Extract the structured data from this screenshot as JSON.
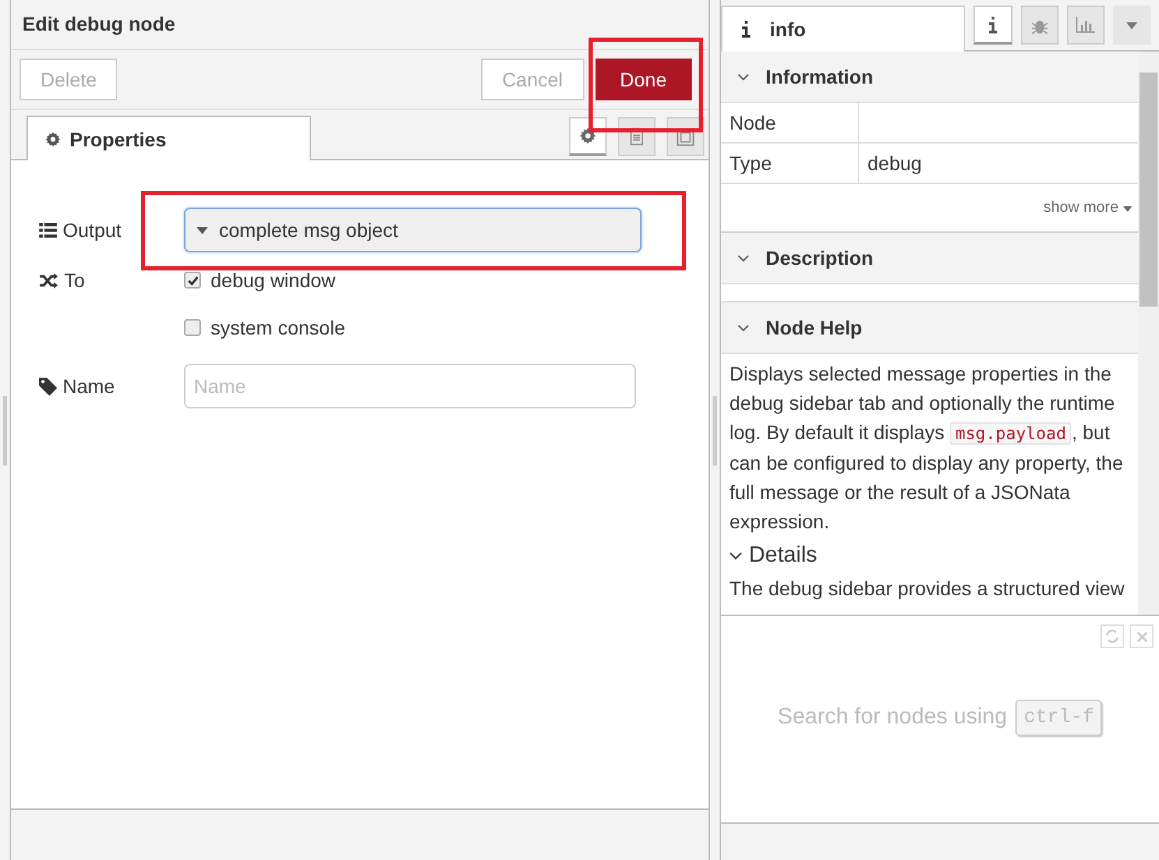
{
  "editor": {
    "title": "Edit debug node",
    "buttons": [
      {
        "label": "Delete",
        "kind": "default"
      },
      {
        "label": "Cancel",
        "kind": "default"
      },
      {
        "label": "Done",
        "kind": "primary"
      }
    ],
    "tabs": [
      {
        "label": "Properties",
        "selected": true
      }
    ],
    "tab_icons": [
      {
        "selected": true
      },
      {
        "selected": false
      },
      {
        "selected": false
      }
    ],
    "fields": [
      {
        "kind": "select",
        "label": "Output",
        "value": "complete msg object"
      },
      {
        "kind": "checkboxes",
        "label": "To",
        "options": [
          {
            "label": "debug window",
            "checked": true
          },
          {
            "label": "system console",
            "checked": false
          }
        ]
      },
      {
        "kind": "text",
        "label": "Name",
        "placeholder": "Name"
      }
    ]
  },
  "sidebar": {
    "tabs": [
      {
        "label": "info",
        "selected": true
      }
    ],
    "tab_icons": [
      {
        "selected": true
      },
      {
        "selected": false
      },
      {
        "selected": false
      }
    ],
    "information": {
      "title": "Information",
      "rows": [
        {
          "key": "Node"
        },
        {
          "key": "Type",
          "value": "debug"
        }
      ],
      "show_more": "show more"
    },
    "description": {
      "title": "Description"
    },
    "node_help": {
      "title": "Node Help",
      "before": "Displays selected message properties in the debug sidebar tab and optionally the runtime log. By default it displays ",
      "code": "msg.payload",
      "after": ", but can be configured to display any property, the full message or the result of a JSONata expression.",
      "details": "Details",
      "details_text": "The debug sidebar provides a structured view"
    },
    "search": {
      "text": "Search for nodes using",
      "key": "ctrl-f"
    }
  }
}
